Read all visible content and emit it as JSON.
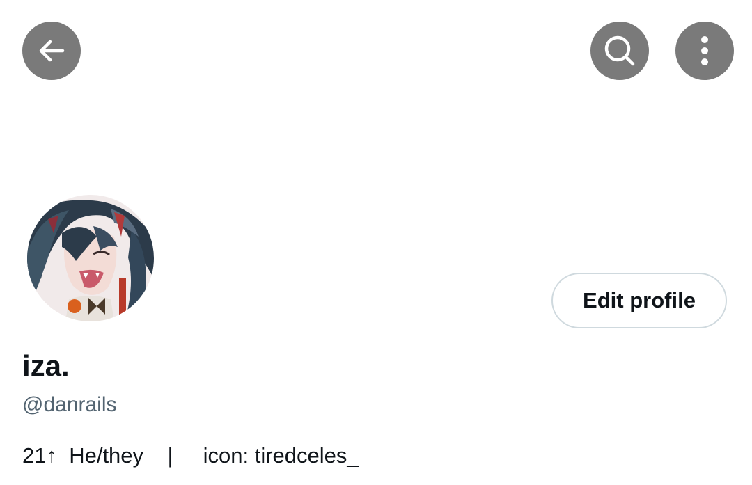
{
  "header": {
    "back_icon": "arrow-left-icon",
    "search_icon": "search-icon",
    "more_icon": "more-vertical-icon",
    "button_color": "#7a7a7a"
  },
  "profile": {
    "display_name": "iza.",
    "handle": "@danrails",
    "bio": "21↑  He/they    |     icon: tiredceles_",
    "edit_button_label": "Edit profile"
  },
  "colors": {
    "primary_text": "#0f1419",
    "secondary_text": "#536471",
    "button_border": "#cfd9de"
  }
}
